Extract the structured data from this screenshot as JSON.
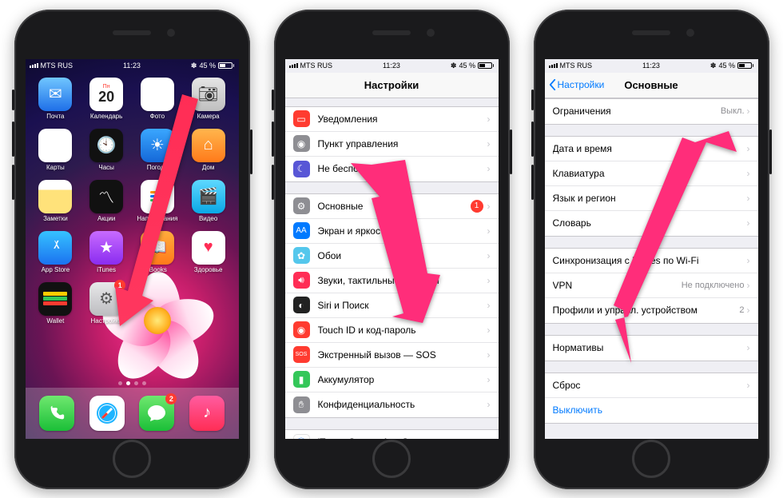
{
  "status": {
    "carrier": "MTS RUS",
    "time": "11:23",
    "battery_pct": "45 %",
    "bt_glyph": "✽"
  },
  "phone1": {
    "cal_dow": "Пн",
    "cal_day": "20",
    "apps_row1": [
      "Почта",
      "Календарь",
      "Фото",
      "Камера"
    ],
    "apps_row2": [
      "Карты",
      "Часы",
      "Погода",
      "Дом"
    ],
    "apps_row3": [
      "Заметки",
      "Акции",
      "Напоминания",
      "Видео"
    ],
    "apps_row4": [
      "App Store",
      "iTunes",
      "iBooks",
      "Здоровье"
    ],
    "apps_row5": [
      "Wallet",
      "Настройки"
    ],
    "settings_badge": "1",
    "messages_badge": "2"
  },
  "phone2": {
    "title": "Настройки",
    "rows": {
      "notif": "Уведомления",
      "cc": "Пункт управления",
      "dnd": "Не беспокоить",
      "general": "Основные",
      "general_badge": "1",
      "display": "Экран и яркость",
      "wall": "Обои",
      "sounds": "Звуки, тактильные сигналы",
      "siri": "Siri и Поиск",
      "touchid": "Touch ID и код-пароль",
      "sos": "Экстренный вызов — SOS",
      "battery": "Аккумулятор",
      "privacy": "Конфиденциальность",
      "itunes": "iTunes Store и App Store"
    }
  },
  "phone3": {
    "back": "Настройки",
    "title": "Основные",
    "rows": {
      "restrictions": "Ограничения",
      "restrictions_val": "Выкл.",
      "datetime": "Дата и время",
      "keyboard": "Клавиатура",
      "lang": "Язык и регион",
      "dict": "Словарь",
      "sync": "Синхронизация с iTunes по Wi-Fi",
      "vpn": "VPN",
      "vpn_val": "Не подключено",
      "profiles": "Профили и управл. устройством",
      "profiles_val": "2",
      "regulatory": "Нормативы",
      "reset": "Сброс",
      "shutdown": "Выключить"
    }
  }
}
